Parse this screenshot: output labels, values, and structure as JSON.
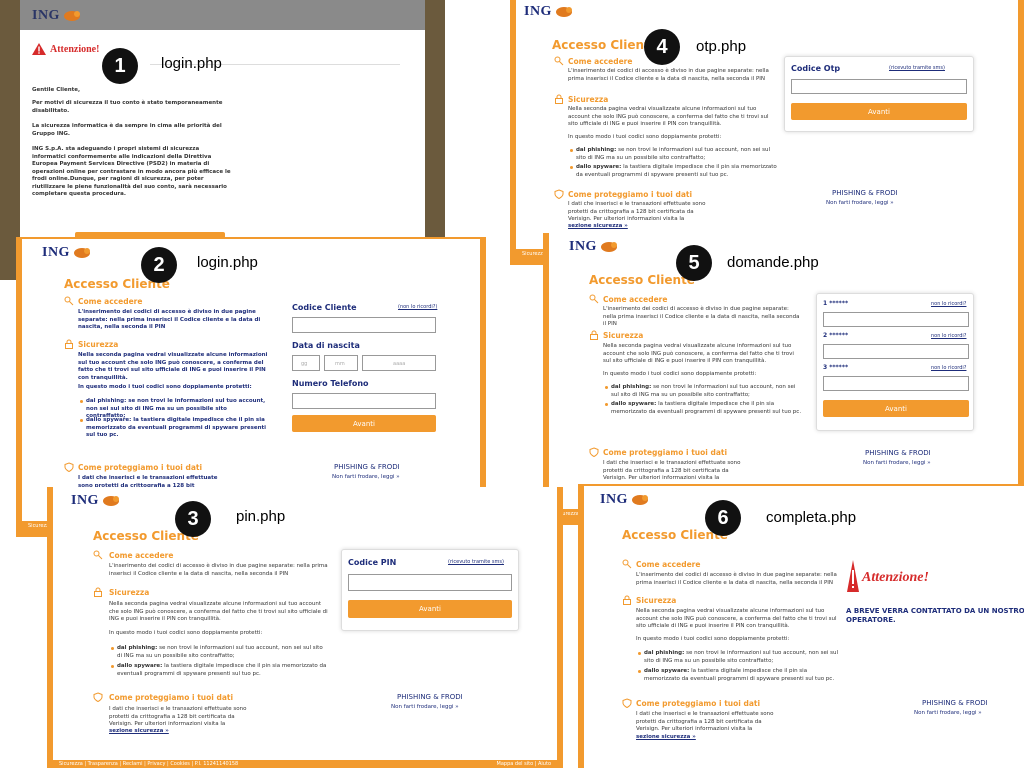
{
  "brand": {
    "logo_text": "ING",
    "accent": "#f29a2e",
    "navy": "#1e2d7a"
  },
  "badges": [
    {
      "num": "1",
      "file": "login.php"
    },
    {
      "num": "2",
      "file": "login.php"
    },
    {
      "num": "3",
      "file": "pin.php"
    },
    {
      "num": "4",
      "file": "otp.php"
    },
    {
      "num": "5",
      "file": "domande.php"
    },
    {
      "num": "6",
      "file": "completa.php"
    }
  ],
  "panel1": {
    "alert_title": "Attenzione!",
    "greeting": "Gentile Cliente,",
    "p1": "Per motivi di sicurezza il tuo conto è stato temporaneamente disabilitato.",
    "p2": "La sicurezza informatica è da sempre in cima alle priorità del Gruppo ING.",
    "p3": "ING S.p.A. sta adeguando i propri sistemi di sicurezza informatici conformemente alle indicazioni della Direttiva Europea Payment Services Directive (PSD2) in materia di operazioni online per contrastare in modo ancora più efficace le frodi online.Dunque, per ragioni di sicurezza, per poter riutilizzare le piene funzionalità del suo conto, sarà necessario completare questa procedura."
  },
  "common": {
    "heading": "Accesso Cliente",
    "come_accedere": "Come accedere",
    "come_accedere_text": "L'inserimento dei codici di accesso è diviso in due pagine separate: nella prima inserisci il Codice cliente e la data di nascita, nella seconda il PIN",
    "sicurezza": "Sicurezza",
    "sicurezza_text": "Nella seconda pagina vedrai visualizzate alcune informazioni sul tuo account che solo ING può conoscere, a conferma del fatto che ti trovi sul sito ufficiale di ING e puoi inserire il PIN con tranquillità.",
    "protetti": "In questo modo i tuoi codici sono doppiamente protetti:",
    "b1_strong": "dal phishing:",
    "b1_text": " se non trovi le informazioni sul tuo account, non sei sul sito di ING ma su un possibile sito contraffatto;",
    "b2_strong": "dallo spyware:",
    "b2_text": " la tastiera digitale impedisce che il pin sia memorizzato da eventuali programmi di spyware presenti sul tuo pc.",
    "proteggiamo": "Come proteggiamo i tuoi dati",
    "proteggiamo_text": "I dati che inserisci e le transazioni effettuate sono protetti da crittografia a 128 bit certificata da Verisign. Per ulteriori informazioni visita la",
    "sezione_link": "sezione sicurezza »",
    "phishing_title": "PHISHING & FRODI",
    "phishing_link": "Non farti frodare, leggi »",
    "btn_avanti": "Avanti"
  },
  "panel2": {
    "codice_cliente": "Codice Cliente",
    "non_ricordi": "(non lo ricordi?)",
    "data_nascita": "Data di nascita",
    "date_placeholders": [
      "gg",
      "mm",
      "aaaa"
    ],
    "numero_telefono": "Numero Telefono"
  },
  "panel3": {
    "codice_pin": "Codice PIN",
    "ricevuto": "(ricevuto tramite sms)",
    "footer": "Sicurezza | Trasparenza | Reclami | Privacy | Cookies | P.I. 11241140158",
    "footer_right": "Mappa del sito | Aiuto"
  },
  "panel4": {
    "codice_otp": "Codice Otp",
    "ricevuto": "(ricevuto tramite sms)",
    "footer": "Sicurezza"
  },
  "panel5": {
    "q1": "1 ******",
    "q2": "2 ******",
    "q3": "3 ******",
    "non_ricordi": "non lo ricordi?",
    "footer": "Sicurezza"
  },
  "panel6": {
    "attenzione": "Attenzione!",
    "message": "A BREVE VERRA CONTATTATO DA UN NOSTRO OPERATORE."
  },
  "panel2_footer": "Sicurezza"
}
